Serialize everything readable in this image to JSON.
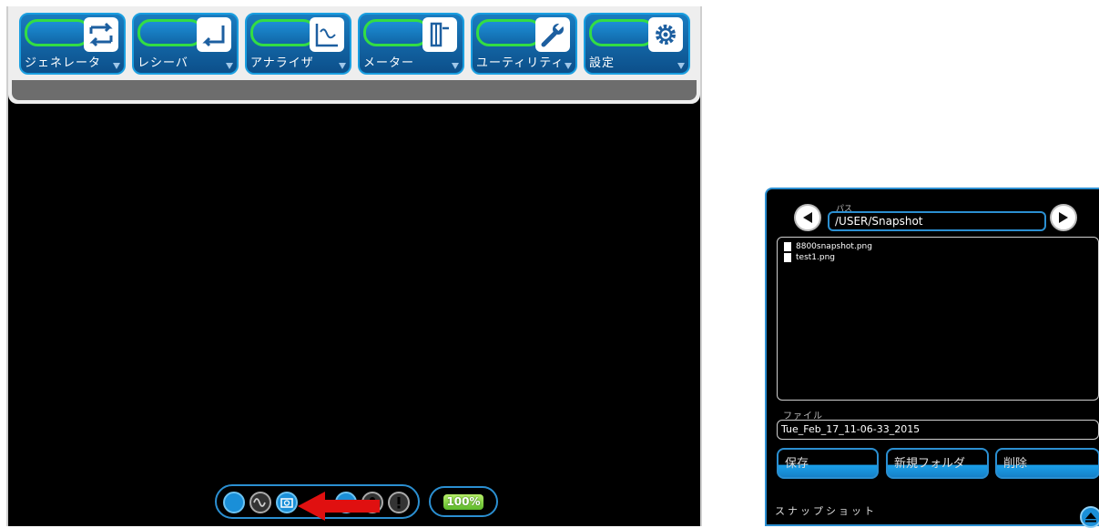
{
  "menu": {
    "items": [
      {
        "label": "ジェネレータ",
        "icon": "generator-arrows-icon"
      },
      {
        "label": "レシーバ",
        "icon": "receiver-arrow-icon"
      },
      {
        "label": "アナライザ",
        "icon": "analyzer-wave-icon"
      },
      {
        "label": "メーター",
        "icon": "meter-icon"
      },
      {
        "label": "ユーティリティ",
        "icon": "wrench-icon"
      },
      {
        "label": "設定",
        "icon": "gear-icon"
      }
    ]
  },
  "status": {
    "battery_label": "100%",
    "icons": [
      "circle-indicator-icon",
      "waveform-icon",
      "camera-icon",
      "globe-icon",
      "key-icon",
      "alert-icon"
    ]
  },
  "snapshot": {
    "path_label": "パス",
    "path_value": "/USER/Snapshot",
    "files": [
      "8800snapshot.png",
      "test1.png"
    ],
    "file_label": "ファイル",
    "file_value": "Tue_Feb_17_11-06-33_2015",
    "buttons": {
      "save": "保存",
      "new_folder": "新規フォルダ",
      "delete": "削除"
    },
    "title": "スナップショット"
  },
  "colors": {
    "accent": "#2b8fd1",
    "glow": "#33dd44",
    "battery": "#7ed34a",
    "arrow": "#e01010"
  }
}
